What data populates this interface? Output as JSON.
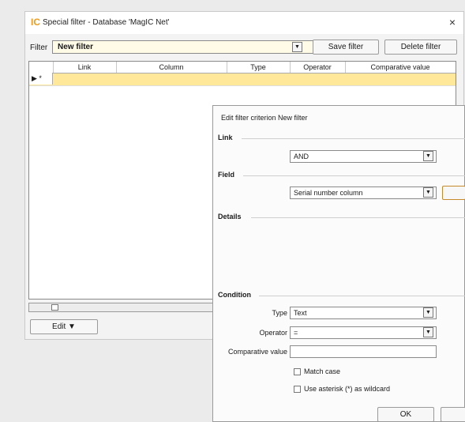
{
  "window": {
    "title": "Special filter - Database 'MagIC Net'",
    "close_glyph": "×",
    "logo_glyph": "IC"
  },
  "filter_bar": {
    "label": "Filter",
    "selected": "New filter",
    "save_label": "Save filter",
    "delete_label": "Delete filter"
  },
  "grid": {
    "columns": [
      "Link",
      "Column",
      "Type",
      "Operator",
      "Comparative value"
    ],
    "row_marker": "▶ *"
  },
  "edit_button": "Edit ▼",
  "dialog": {
    "title": "Edit filter criterion New filter",
    "sections": {
      "link": "Link",
      "field": "Field",
      "details": "Details",
      "condition": "Condition"
    },
    "link_value": "AND",
    "field_value": "Serial number column",
    "type_label": "Type",
    "type_value": "Text",
    "operator_label": "Operator",
    "operator_value": "=",
    "comparative_label": "Comparative value",
    "comparative_value": "",
    "match_case_label": "Match case",
    "wildcard_label": "Use asterisk (*) as wildcard",
    "ok_label": "OK"
  }
}
